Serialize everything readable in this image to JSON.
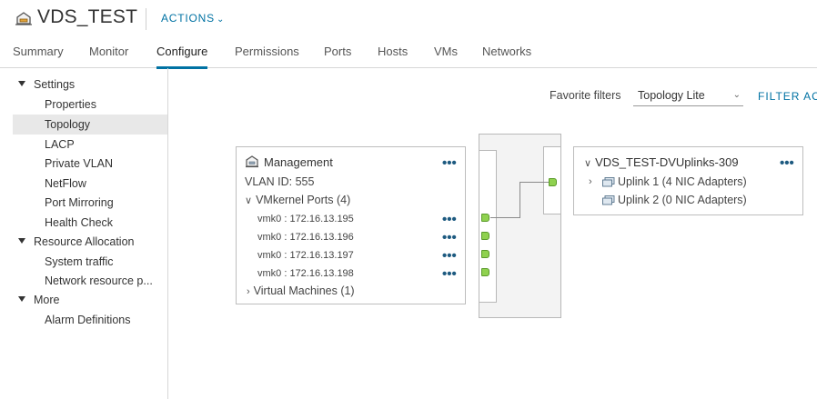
{
  "header": {
    "title": "VDS_TEST",
    "actions_label": "ACTIONS",
    "object_icon": "distributed-switch-icon"
  },
  "tabs": [
    {
      "label": "Summary"
    },
    {
      "label": "Monitor"
    },
    {
      "label": "Configure",
      "active": true
    },
    {
      "label": "Permissions"
    },
    {
      "label": "Ports"
    },
    {
      "label": "Hosts"
    },
    {
      "label": "VMs"
    },
    {
      "label": "Networks"
    }
  ],
  "sidebar": {
    "sections": [
      {
        "label": "Settings",
        "items": [
          "Properties",
          "Topology",
          "LACP",
          "Private VLAN",
          "NetFlow",
          "Port Mirroring",
          "Health Check"
        ]
      },
      {
        "label": "Resource Allocation",
        "items": [
          "System traffic",
          "Network resource p..."
        ]
      },
      {
        "label": "More",
        "items": [
          "Alarm Definitions"
        ]
      }
    ],
    "selected": "Topology"
  },
  "filters": {
    "favorite_label": "Favorite filters",
    "selected_value": "Topology Lite",
    "filter_button": "FILTER AC"
  },
  "portgroup": {
    "title": "Management",
    "vlan": "VLAN ID: 555",
    "vmkernel_label": "VMkernel Ports (4)",
    "ports": [
      "vmk0 : 172.16.13.195",
      "vmk0 : 172.16.13.196",
      "vmk0 : 172.16.13.197",
      "vmk0 : 172.16.13.198"
    ],
    "vms_label": "Virtual Machines (1)",
    "more_glyph": "•••"
  },
  "uplinks": {
    "title": "VDS_TEST-DVUplinks-309",
    "items": [
      "Uplink 1 (4 NIC Adapters)",
      "Uplink 2 (0 NIC Adapters)"
    ],
    "more_glyph": "•••"
  },
  "colors": {
    "accent": "#0072a3",
    "port_green": "#8fd14f",
    "selected_bg": "#e8e8e8"
  }
}
